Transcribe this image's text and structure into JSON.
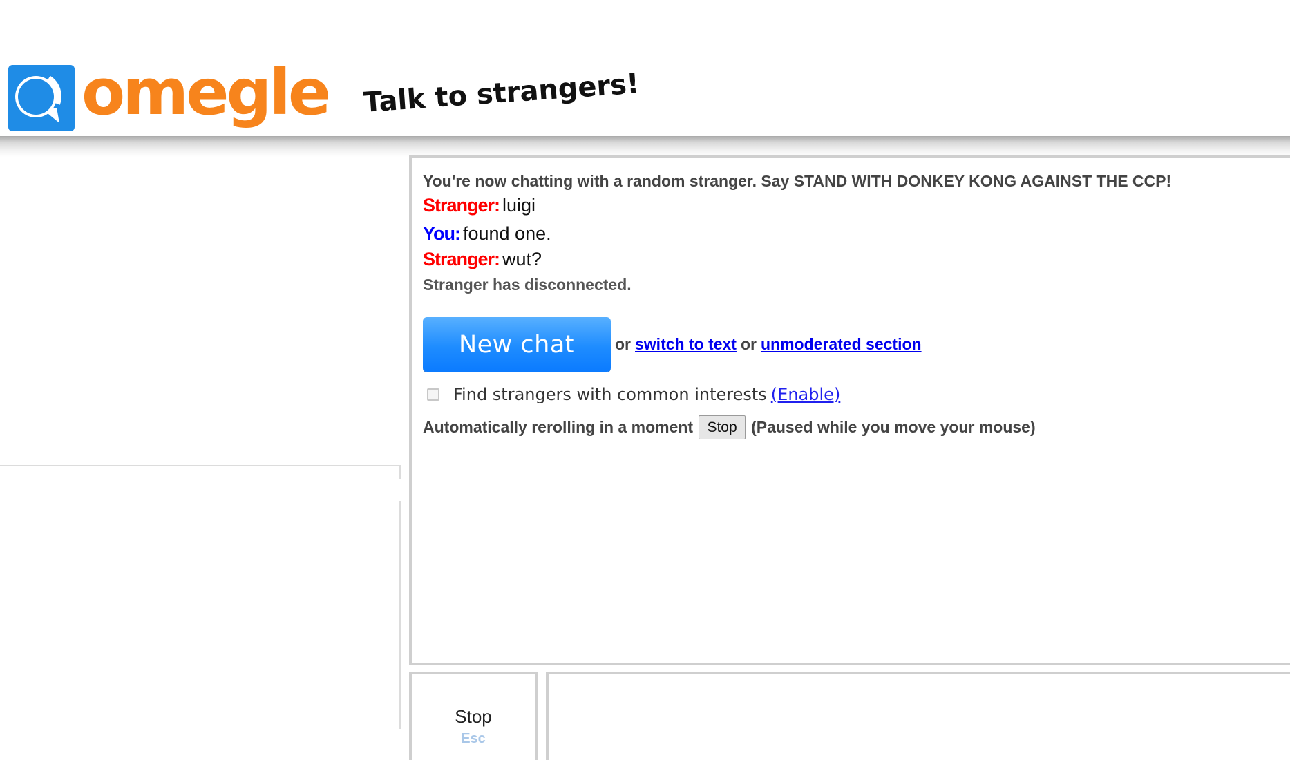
{
  "header": {
    "logo_text": "omegle",
    "tagline": "Talk to strangers!"
  },
  "chat": {
    "status": "You're now chatting with a random stranger. Say STAND WITH DONKEY KONG AGAINST THE CCP!",
    "messages": [
      {
        "sender": "Stranger:",
        "text": "luigi"
      },
      {
        "sender": "You:",
        "text": "found one."
      },
      {
        "sender": "Stranger:",
        "text": "wut?"
      }
    ],
    "disconnected": "Stranger has disconnected.",
    "new_chat_label": "New chat",
    "or_1": "or",
    "switch_to_text": "switch to text",
    "or_2": "or",
    "unmoderated_section": "unmoderated section",
    "interests_label": "Find strangers with common interests",
    "enable_link": "(Enable)",
    "reroll_text": "Automatically rerolling in a moment",
    "reroll_stop": "Stop",
    "reroll_paused": "(Paused while you move your mouse)"
  },
  "controls": {
    "stop_label": "Stop",
    "esc_hint": "Esc"
  },
  "colors": {
    "brand_orange": "#f7841c",
    "brand_blue": "#1f8ce6",
    "stranger_red": "#ff0000",
    "you_blue": "#0000ff",
    "new_chat_blue": "#1e8cff"
  }
}
